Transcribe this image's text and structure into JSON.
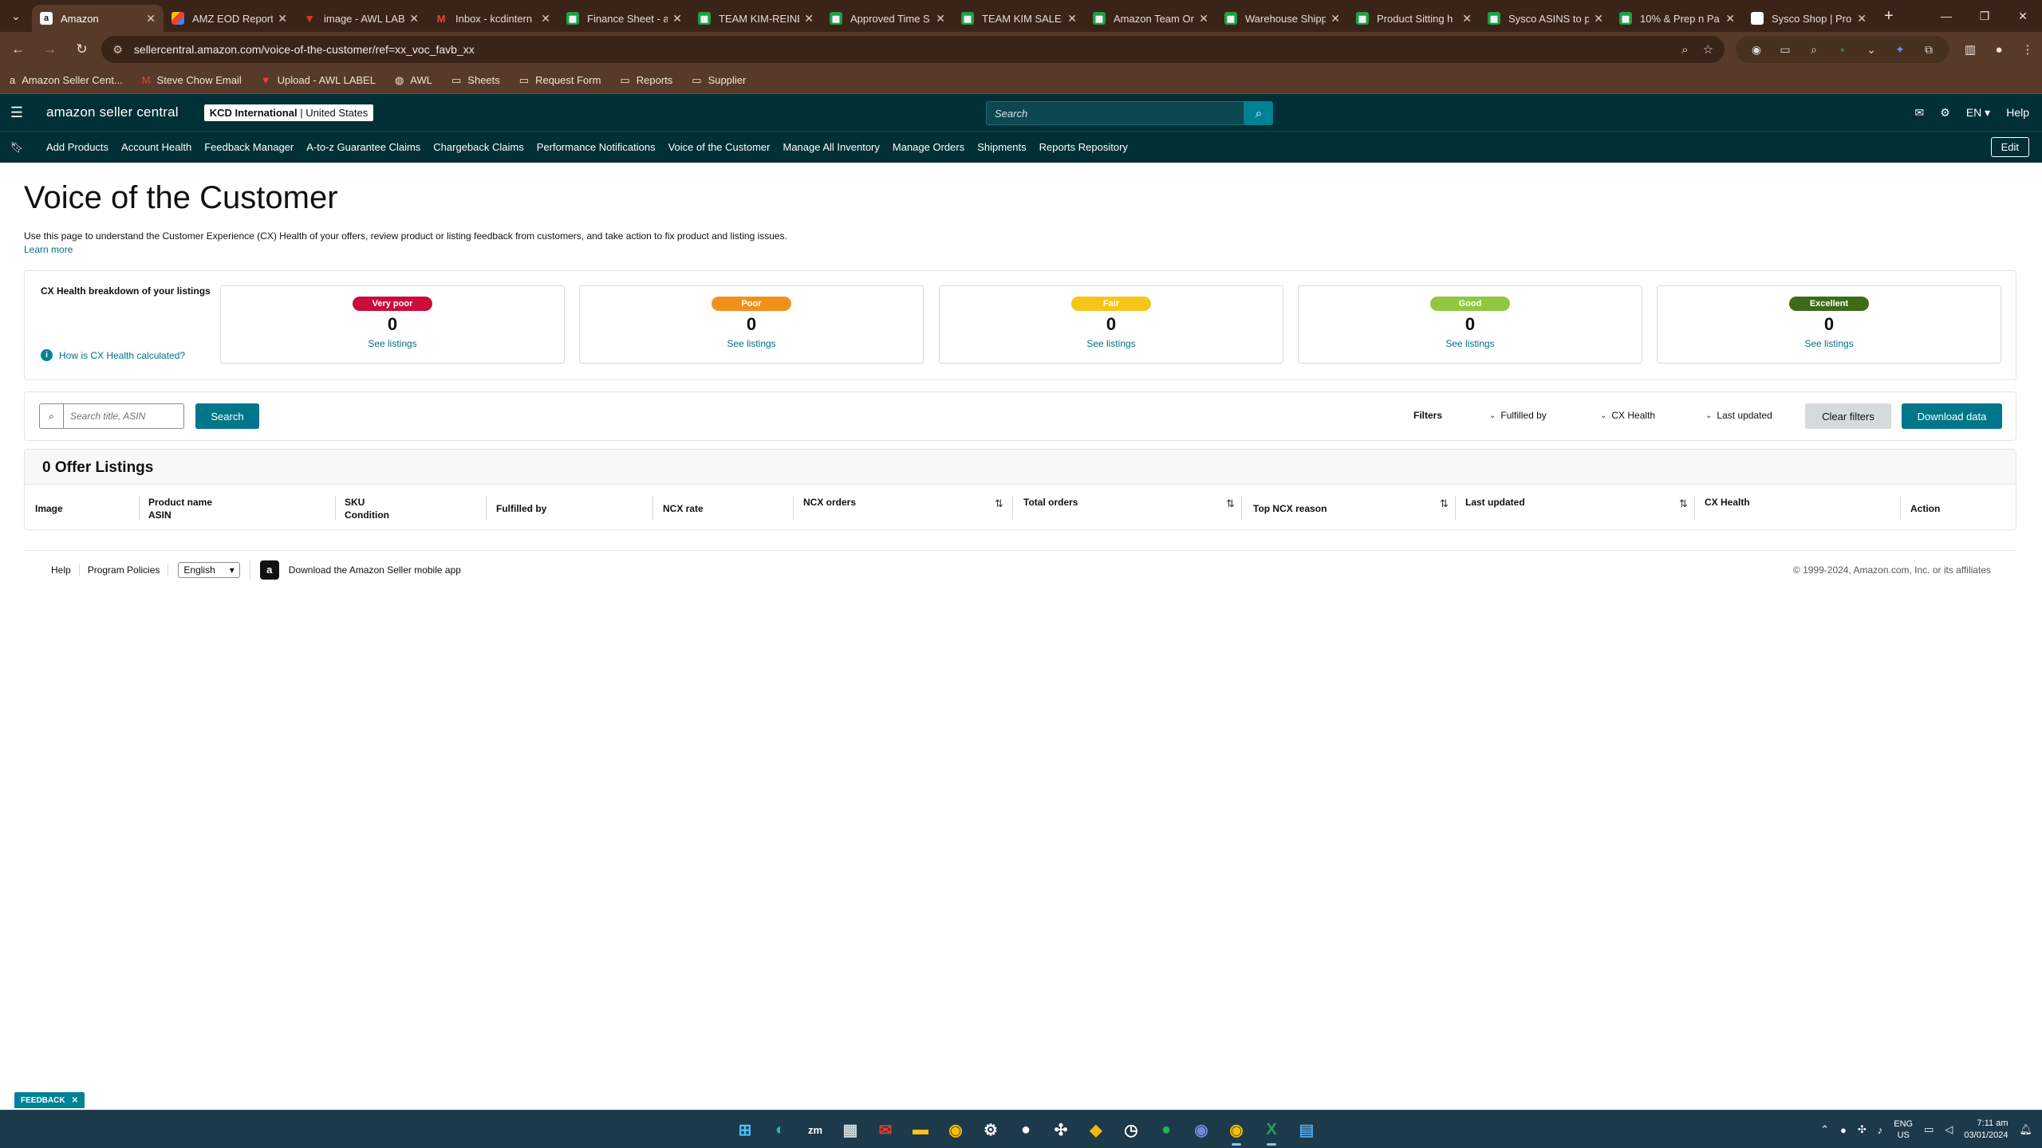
{
  "browser": {
    "tabs": [
      {
        "title": "Amazon",
        "favicon": "amazon-icon",
        "active": true
      },
      {
        "title": "AMZ EOD Report",
        "favicon": "multicolor-icon"
      },
      {
        "title": "image - AWL LAB",
        "favicon": "awl-icon"
      },
      {
        "title": "Inbox - kcdintern",
        "favicon": "gmail-icon"
      },
      {
        "title": "Finance Sheet - a",
        "favicon": "sheets-icon"
      },
      {
        "title": "TEAM KIM-REINE",
        "favicon": "sheets-icon"
      },
      {
        "title": "Approved Time S",
        "favicon": "sheets-icon"
      },
      {
        "title": "TEAM KIM SALES",
        "favicon": "sheets-icon"
      },
      {
        "title": "Amazon Team Or",
        "favicon": "sheets-icon"
      },
      {
        "title": "Warehouse Shipp",
        "favicon": "sheets-icon"
      },
      {
        "title": "Product Sitting h",
        "favicon": "sheets-icon"
      },
      {
        "title": "Sysco ASINS to p",
        "favicon": "sheets-icon"
      },
      {
        "title": "10% & Prep n Pa",
        "favicon": "sheets-icon"
      },
      {
        "title": "Sysco Shop | Pro",
        "favicon": "document-icon"
      }
    ],
    "url": "sellercentral.amazon.com/voice-of-the-customer/ref=xx_voc_favb_xx",
    "bookmarks": [
      {
        "label": "Amazon Seller Cent...",
        "icon": "amazon-icon"
      },
      {
        "label": "Steve Chow Email",
        "icon": "gmail-icon"
      },
      {
        "label": "Upload - AWL LABEL",
        "icon": "awl-icon"
      },
      {
        "label": "AWL",
        "icon": "globe-icon"
      },
      {
        "label": "Sheets",
        "icon": "folder-icon"
      },
      {
        "label": "Request Form",
        "icon": "folder-icon"
      },
      {
        "label": "Reports",
        "icon": "folder-icon"
      },
      {
        "label": "Supplier",
        "icon": "folder-icon"
      }
    ]
  },
  "header": {
    "logo": "amazon seller central",
    "account_name": "KCD International",
    "account_region": "United States",
    "search_placeholder": "Search",
    "language": "EN",
    "help": "Help"
  },
  "nav": {
    "links": [
      "Add Products",
      "Account Health",
      "Feedback Manager",
      "A-to-z Guarantee Claims",
      "Chargeback Claims",
      "Performance Notifications",
      "Voice of the Customer",
      "Manage All Inventory",
      "Manage Orders",
      "Shipments",
      "Reports Repository"
    ],
    "edit": "Edit"
  },
  "page": {
    "title": "Voice of the Customer",
    "description": "Use this page to understand the Customer Experience (CX) Health of your offers, review product or listing feedback from customers, and take action to fix product and listing issues.",
    "learn_more": "Learn more"
  },
  "cx_health": {
    "title": "CX Health breakdown of your listings",
    "help_link": "How is CX Health calculated?",
    "cards": [
      {
        "label": "Very poor",
        "count": "0",
        "link": "See listings",
        "badge_bg": "#cc0c39",
        "badge_fg": "#ffffff"
      },
      {
        "label": "Poor",
        "count": "0",
        "link": "See listings",
        "badge_bg": "#f3901c",
        "badge_fg": "#ffffff"
      },
      {
        "label": "Fair",
        "count": "0",
        "link": "See listings",
        "badge_bg": "#f5c518",
        "badge_fg": "#ffffff"
      },
      {
        "label": "Good",
        "count": "0",
        "link": "See listings",
        "badge_bg": "#8fc73e",
        "badge_fg": "#ffffff"
      },
      {
        "label": "Excellent",
        "count": "0",
        "link": "See listings",
        "badge_bg": "#3d6b18",
        "badge_fg": "#ffffff"
      }
    ]
  },
  "filters": {
    "search_placeholder": "Search title, ASIN",
    "search_button": "Search",
    "label": "Filters",
    "dropdowns": [
      "Fulfilled by",
      "CX Health",
      "Last updated"
    ],
    "clear": "Clear filters",
    "download": "Download data"
  },
  "listings": {
    "count_title": "0 Offer Listings",
    "columns": [
      {
        "line1": "Image",
        "line2": ""
      },
      {
        "line1": "Product name",
        "line2": "ASIN"
      },
      {
        "line1": "SKU",
        "line2": "Condition"
      },
      {
        "line1": "Fulfilled by",
        "line2": ""
      },
      {
        "line1": "NCX rate",
        "line2": ""
      },
      {
        "line1": "NCX orders",
        "line2": ""
      },
      {
        "line1": "Total orders",
        "line2": ""
      },
      {
        "line1": "Top NCX reason",
        "line2": ""
      },
      {
        "line1": "Last updated",
        "line2": ""
      },
      {
        "line1": "CX Health",
        "line2": ""
      },
      {
        "line1": "Action",
        "line2": ""
      }
    ]
  },
  "footer": {
    "help": "Help",
    "policies": "Program Policies",
    "language": "English",
    "app_link": "Download the Amazon Seller mobile app",
    "copyright": "© 1999-2024, Amazon.com, Inc. or its affiliates"
  },
  "feedback": "FEEDBACK",
  "taskbar": {
    "lang_top": "ENG",
    "lang_bottom": "US",
    "time": "7:11 am",
    "date": "03/01/2024"
  }
}
